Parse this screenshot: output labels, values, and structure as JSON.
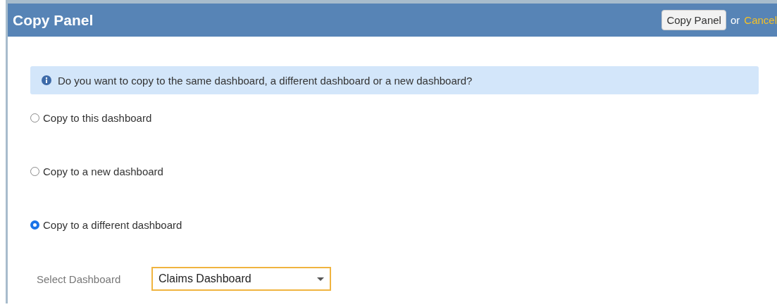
{
  "header": {
    "title": "Copy Panel",
    "primary_button": "Copy Panel",
    "separator": "or",
    "cancel_link": "Cancel"
  },
  "info": {
    "message": "Do you want to copy to the same dashboard, a different dashboard or a new dashboard?"
  },
  "options": [
    {
      "label": "Copy to this dashboard",
      "selected": false
    },
    {
      "label": "Copy to a new dashboard",
      "selected": false
    },
    {
      "label": "Copy to a different dashboard",
      "selected": true
    }
  ],
  "dashboard_select": {
    "label": "Select Dashboard",
    "value": "Claims Dashboard"
  }
}
